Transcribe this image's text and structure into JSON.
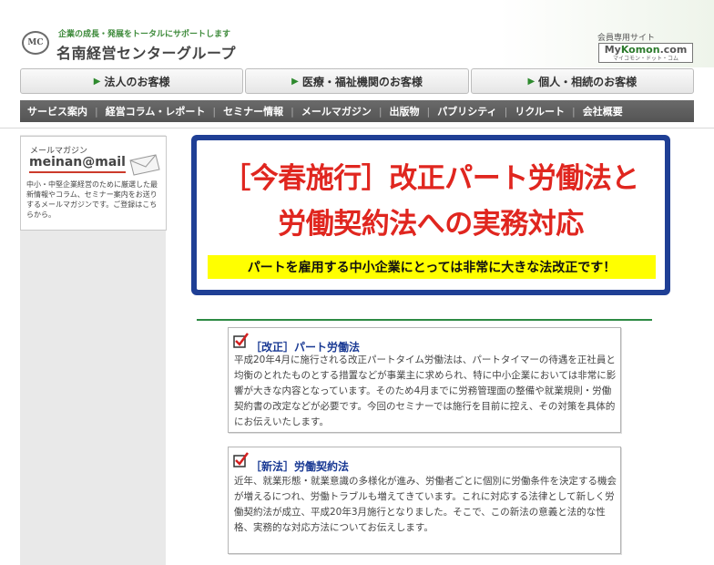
{
  "header": {
    "logo_text": "MC",
    "tagline": "企業の成長・発展をトータルにサポートします",
    "brand": "名南経営センターグループ",
    "member_label": "会員専用サイト",
    "mykomon_prefix": "My",
    "mykomon_brand": "Komon",
    "mykomon_suffix": ".com",
    "mykomon_reading": "マイコモン・ドット・コム"
  },
  "category_tabs": [
    {
      "label": "法人のお客様"
    },
    {
      "label": "医療・福祉機関のお客様"
    },
    {
      "label": "個人・相続のお客様"
    }
  ],
  "menu": [
    {
      "label": "サービス案内"
    },
    {
      "label": "経営コラム・レポート"
    },
    {
      "label": "セミナー情報"
    },
    {
      "label": "メールマガジン"
    },
    {
      "label": "出版物"
    },
    {
      "label": "パブリシティ"
    },
    {
      "label": "リクルート"
    },
    {
      "label": "会社概要"
    }
  ],
  "mailmag": {
    "label": "メールマガジン",
    "title": "meinan@mail",
    "description": "中小・中堅企業経営のために厳選した最新情報やコラム、セミナー案内をお送りするメールマガジンです。ご登録はこちらから。"
  },
  "banner": {
    "title_line1": "［今春施行］改正パート労働法と",
    "title_line2": "労働契約法への実務対応",
    "subtitle": "パートを雇用する中小企業にとっては非常に大きな法改正です！"
  },
  "sections": [
    {
      "heading": "［改正］パート労働法",
      "text": "平成20年4月に施行される改正パートタイム労働法は、パートタイマーの待遇を正社員と均衡のとれたものとする措置などが事業主に求められ、特に中小企業においては非常に影響が大きな内容となっています。そのため4月までに労務管理面の整備や就業規則・労働契約書の改定などが必要です。今回のセミナーでは施行を目前に控え、その対策を具体的にお伝えいたします。"
    },
    {
      "heading": "［新法］労働契約法",
      "text": "近年、就業形態・就業意識の多様化が進み、労働者ごとに個別に労働条件を決定する機会が増えるにつれ、労働トラブルも増えてきています。これに対応する法律として新しく労働契約法が成立、平成20年3月施行となりました。そこで、この新法の意義と法的な性格、実務的な対応方法についてお伝えします。"
    }
  ],
  "colors": {
    "accent_green": "#2d8a43",
    "banner_blue": "#1f3f95",
    "banner_red": "#e0261f",
    "highlight_yellow": "#ffff00",
    "menu_gray": "#5e5e5e"
  }
}
